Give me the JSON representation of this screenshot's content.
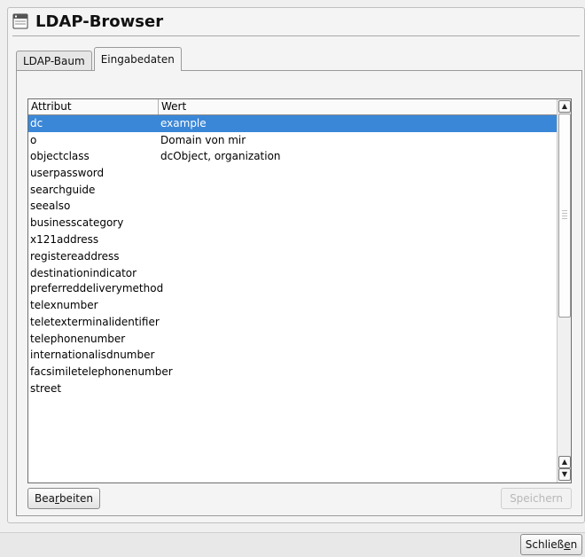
{
  "window": {
    "title": "LDAP-Browser",
    "icon": "app-window-icon"
  },
  "tabs": [
    {
      "label": "LDAP-Baum",
      "active": false
    },
    {
      "label": "Eingabedaten",
      "active": true
    }
  ],
  "table": {
    "columns": [
      "Attribut",
      "Wert"
    ],
    "rows": [
      {
        "attr": "dc",
        "value": "example",
        "selected": true
      },
      {
        "attr": "o",
        "value": "Domain von mir"
      },
      {
        "attr": "objectclass",
        "value": "dcObject, organization"
      },
      {
        "attr": "userpassword",
        "value": ""
      },
      {
        "attr": "searchguide",
        "value": ""
      },
      {
        "attr": "seealso",
        "value": ""
      },
      {
        "attr": "businesscategory",
        "value": ""
      },
      {
        "attr": "x121address",
        "value": ""
      },
      {
        "attr": "registereaddress",
        "value": ""
      },
      {
        "attr": "destinationindicator",
        "value": ""
      },
      {
        "attr": "preferreddeliverymethod",
        "value": ""
      },
      {
        "attr": "telexnumber",
        "value": ""
      },
      {
        "attr": "teletexterminalidentifier",
        "value": ""
      },
      {
        "attr": "telephonenumber",
        "value": ""
      },
      {
        "attr": "internationalisdnumber",
        "value": ""
      },
      {
        "attr": "facsimiletelephonenumber",
        "value": ""
      },
      {
        "attr": "street",
        "value": ""
      }
    ]
  },
  "buttons": {
    "edit": {
      "label": "Bearbeiten",
      "mnemonic_before": "Bea",
      "mnemonic_char": "r",
      "mnemonic_after": "beiten"
    },
    "save": {
      "label": "Speichern",
      "enabled": false
    },
    "close": {
      "label": "Schließen",
      "mnemonic_before": "Schließ",
      "mnemonic_char": "e",
      "mnemonic_after": "n"
    }
  },
  "colors": {
    "selection": "#3a87d8",
    "background": "#efefef"
  }
}
